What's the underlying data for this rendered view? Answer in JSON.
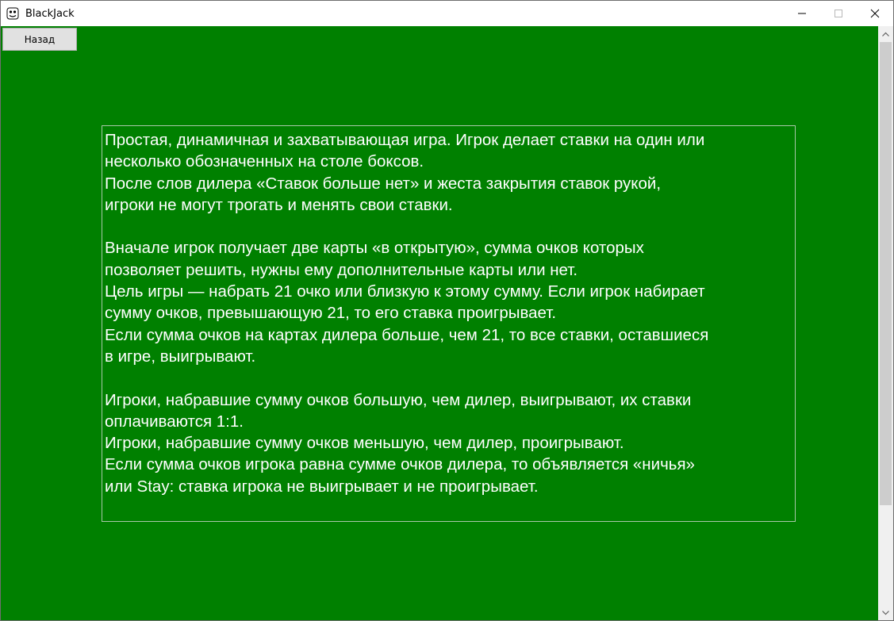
{
  "window": {
    "title": "BlackJack",
    "icon": "app-icon",
    "controls": [
      "minimize-icon",
      "maximize-icon",
      "close-icon"
    ]
  },
  "toolbar": {
    "back_label": "Назад"
  },
  "rules": {
    "lines": [
      "Простая, динамичная и захватывающая игра. Игрок делает ставки на один или",
      "несколько обозначенных на столе боксов.",
      "После слов дилера «Ставок больше нет» и жеста закрытия ставок рукой,",
      "игроки не могут трогать и менять свои ставки.",
      "",
      "Вначале игрок получает две карты «в открытую», сумма очков которых",
      "позволяет решить, нужны ему дополнительные карты или нет.",
      "Цель игры — набрать 21 очко или близкую к этому сумму. Если игрок набирает",
      "сумму очков, превышающую 21, то его ставка проигрывает.",
      "Если сумма очков на картах дилера больше, чем 21, то все ставки, оставшиеся",
      "в игре, выигрывают.",
      "",
      "Игроки, набравшие сумму очков большую, чем дилер, выигрывают, их ставки",
      "оплачиваются 1:1.",
      "Игроки, набравшие сумму очков меньшую, чем дилер, проигрывают.",
      "Если сумма очков игрока равна сумме очков дилера, то объявляется «ничья»",
      "или Stay: ставка игрока не выигрывает и не проигрывает."
    ]
  },
  "colors": {
    "background": "#008000",
    "text": "#ffffff",
    "button": "#e1e1e1"
  }
}
